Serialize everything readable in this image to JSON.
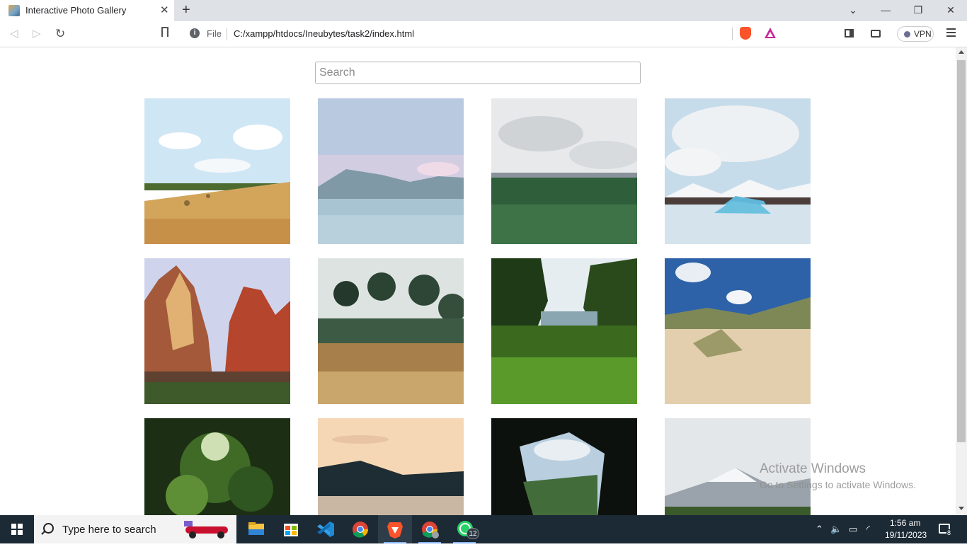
{
  "browser": {
    "tab_title": "Interactive Photo Gallery",
    "close_glyph": "✕",
    "newtab_glyph": "+",
    "file_label": "File",
    "url": "C:/xampp/htdocs/Ineubytes/task2/index.html",
    "vpn_label": "VPN",
    "icons": [
      "back-icon",
      "forward-icon",
      "reload-icon",
      "bookmark-icon",
      "info-icon",
      "brave-shields-icon",
      "brave-rewards-icon",
      "sidebar-icon",
      "wallet-icon",
      "menu-icon"
    ]
  },
  "window_controls": {
    "dropdown": "⌄",
    "minimize": "—",
    "restore": "❐",
    "close": "✕"
  },
  "page": {
    "search_placeholder": "Search",
    "photos": [
      {
        "subject": "hay field under cloudy sky"
      },
      {
        "subject": "mountain lake"
      },
      {
        "subject": "green grassland"
      },
      {
        "subject": "glacier lagoon"
      },
      {
        "subject": "red canyon cliffs"
      },
      {
        "subject": "forest garden"
      },
      {
        "subject": "green valley"
      },
      {
        "subject": "sand dunes"
      },
      {
        "subject": "forest path"
      },
      {
        "subject": "sunset river valley"
      },
      {
        "subject": "cave opening view"
      },
      {
        "subject": "snowy mountain"
      }
    ]
  },
  "watermark": {
    "line1": "Activate Windows",
    "line2": "Go to Settings to activate Windows."
  },
  "taskbar": {
    "search_text": "Type here to search",
    "apps": [
      "file-explorer",
      "microsoft-store",
      "vs-code",
      "chrome",
      "brave",
      "chrome-profile",
      "whatsapp"
    ],
    "whatsapp_badge": "12",
    "time": "1:56 am",
    "date": "19/11/2023",
    "notification_count": "8"
  }
}
